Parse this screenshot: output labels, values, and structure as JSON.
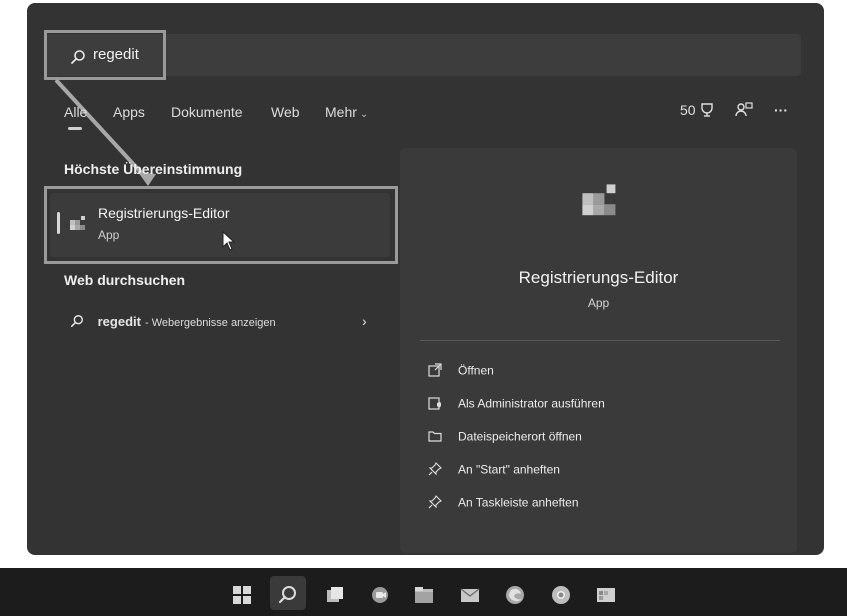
{
  "search": {
    "query": "regedit"
  },
  "tabs": [
    {
      "label": "Alle"
    },
    {
      "label": "Apps"
    },
    {
      "label": "Dokumente"
    },
    {
      "label": "Web"
    },
    {
      "label": "Mehr"
    }
  ],
  "top_right": {
    "points": "50",
    "points_icon": "trophy-icon",
    "account_icon": "account-switch-icon",
    "more_label": "···"
  },
  "best_match": {
    "heading": "Höchste Übereinstimmung",
    "title": "Registrierungs-Editor",
    "subtitle": "App",
    "icon": "registry-editor-icon"
  },
  "web_search": {
    "heading": "Web durchsuchen",
    "query": "regedit",
    "action": "- Webergebnisse anzeigen",
    "chevron": "›"
  },
  "preview": {
    "title": "Registrierungs-Editor",
    "subtitle": "App",
    "actions": [
      {
        "label": "Öffnen",
        "icon": "open-external-icon"
      },
      {
        "label": "Als Administrator ausführen",
        "icon": "shield-admin-icon"
      },
      {
        "label": "Dateispeicherort öffnen",
        "icon": "folder-icon"
      },
      {
        "label": "An \"Start\" anheften",
        "icon": "pin-icon"
      },
      {
        "label": "An Taskleiste anheften",
        "icon": "pin-icon"
      }
    ]
  },
  "taskbar": {
    "icons": [
      "start-icon",
      "search-icon",
      "task-view-icon",
      "chat-icon",
      "file-explorer-icon",
      "mail-icon",
      "edge-icon",
      "chrome-icon",
      "registry-editor-icon"
    ]
  },
  "colors": {
    "panel": "#333333",
    "highlight_box": "#9a9a9a",
    "taskbar": "#1c1c1c"
  }
}
